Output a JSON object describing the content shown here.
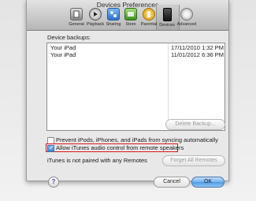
{
  "window": {
    "title": "Devices Preferences"
  },
  "toolbar": {
    "items": [
      {
        "label": "General",
        "icon": "general-icon",
        "color": "#555555"
      },
      {
        "label": "Playback",
        "icon": "playback-icon",
        "color": "#4a4a4a"
      },
      {
        "label": "Sharing",
        "icon": "sharing-icon",
        "color": "#3b7fd6"
      },
      {
        "label": "Store",
        "icon": "store-icon",
        "color": "#5aa83a"
      },
      {
        "label": "Parental",
        "icon": "parental-icon",
        "color": "#e3b21e"
      },
      {
        "label": "Devices",
        "icon": "devices-icon",
        "color": "#222222"
      },
      {
        "label": "Advanced",
        "icon": "advanced-icon",
        "color": "#8a8a8a"
      }
    ],
    "selected": "Devices"
  },
  "backups": {
    "label": "Device backups:",
    "rows": [
      {
        "name": "Your iPad",
        "date": "17/11/2010 1:32 PM"
      },
      {
        "name": "Your iPad",
        "date": "11/01/2012 6:36 PM"
      }
    ],
    "delete_label": "Delete Backup..."
  },
  "options": {
    "prevent_sync": {
      "label": "Prevent iPods, iPhones, and iPads from syncing automatically",
      "checked": false
    },
    "allow_remote": {
      "label": "Allow iTunes audio control from remote speakers",
      "checked": true
    }
  },
  "remotes": {
    "status": "iTunes is not paired with any Remotes",
    "forget_label": "Forget All Remotes"
  },
  "footer": {
    "help": "?",
    "cancel_label": "Cancel",
    "ok_label": "OK"
  },
  "accent": {
    "highlight": "#e0151b",
    "default_button": "#4f9be6"
  }
}
